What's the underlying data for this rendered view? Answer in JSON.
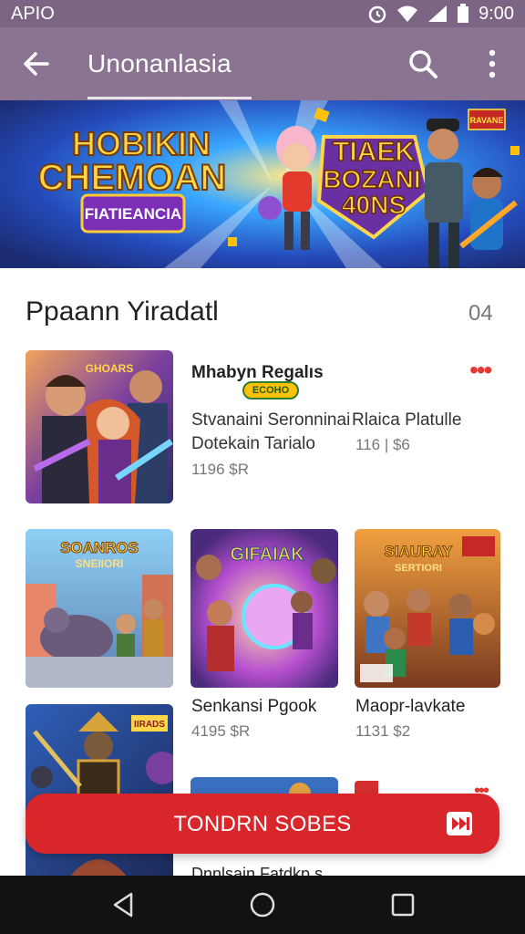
{
  "status": {
    "carrier": "APIO",
    "time": "9:00"
  },
  "appbar": {
    "title": "Unonanlasia",
    "back_icon": "arrow-left-icon",
    "search_icon": "search-icon",
    "more_icon": "more-vert-icon"
  },
  "banner": {
    "left_title_line1": "HOBIKIN",
    "left_title_line2": "CHEMOAN",
    "left_subtitle": "FIATIEANCIA",
    "right_title_line1": "TIAEK",
    "right_title_line2": "BOZANI",
    "right_title_line3": "40NS",
    "badge": "RAVANE"
  },
  "section": {
    "title": "Ppaann Yiradatl",
    "count": "04"
  },
  "featured": {
    "title": "Mhabyn Regalıs",
    "badge": "ECOHO",
    "line1": "Stvanaini Seronninai",
    "line2": "Dotekain Tarialo",
    "price": "1196 $R",
    "right_line1": "Rlaica Platulle",
    "right_price": "116 | $6",
    "thumb_title": "GHOARS"
  },
  "grid": [
    {
      "thumb_title": "SOANROS",
      "thumb_sub": "SNEIIORI"
    },
    {
      "thumb_title": "GIFAIAK"
    },
    {
      "thumb_title": "SIAURAY",
      "thumb_sub": "SERTIORI"
    }
  ],
  "grid_captions": [
    {
      "title": "Senkansi Pgook",
      "price": "4195 $R"
    },
    {
      "title": "Maopr-lavkate",
      "price": "1131 $2"
    }
  ],
  "bottom_row": {
    "thumb_title": "IIRADS",
    "partial_text": "Dnnlsain Fatdkp s"
  },
  "fab": {
    "label": "TONDRN SOBES"
  },
  "navbar": {
    "back": "back-triangle-icon",
    "home": "home-circle-icon",
    "recent": "recents-square-icon"
  },
  "colors": {
    "appbar": "#8a7492",
    "accent": "#d9262a"
  }
}
